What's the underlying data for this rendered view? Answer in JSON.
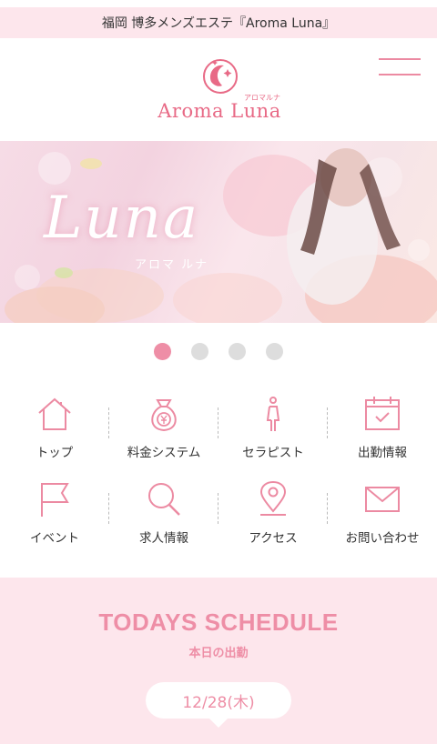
{
  "topbar": {
    "text": "福岡 博多メンズエステ『Aroma Luna』"
  },
  "header": {
    "logo_text": "Aroma Luna",
    "logo_kana": "アロマルナ"
  },
  "hero": {
    "title": "Luna",
    "subtitle": "アロマ ルナ",
    "active_slide": 1,
    "slide_count": 4
  },
  "nav": {
    "items": [
      {
        "label": "トップ",
        "icon": "home-icon"
      },
      {
        "label": "料金システム",
        "icon": "price-bag-icon"
      },
      {
        "label": "セラピスト",
        "icon": "therapist-icon"
      },
      {
        "label": "出勤情報",
        "icon": "calendar-icon"
      },
      {
        "label": "イベント",
        "icon": "flag-icon"
      },
      {
        "label": "求人情報",
        "icon": "search-icon"
      },
      {
        "label": "アクセス",
        "icon": "location-pin-icon"
      },
      {
        "label": "お問い合わせ",
        "icon": "mail-icon"
      }
    ]
  },
  "schedule": {
    "title": "TODAYS SCHEDULE",
    "subtitle": "本日の出勤",
    "date": "12/28(木)"
  },
  "colors": {
    "accent": "#ee8ea6",
    "topbar_bg": "#fde6ec",
    "schedule_bg": "#fde6ec"
  }
}
